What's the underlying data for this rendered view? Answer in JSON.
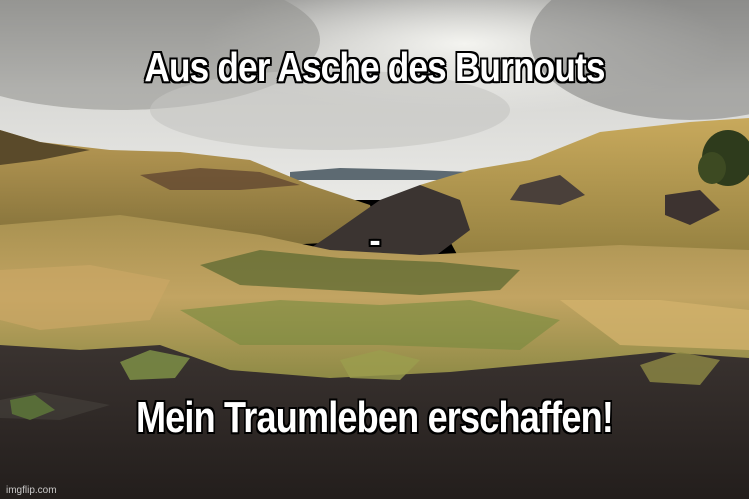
{
  "meme": {
    "top_text": "Aus der Asche des Burnouts",
    "middle_text": "-",
    "bottom_text": "Mein Traumleben erschaffen!",
    "watermark": "imgflip.com"
  },
  "colors": {
    "sky": "#d9d9d6",
    "cloud_dark": "#8a8a88",
    "dry_grass": "#c9a35a",
    "green_grass": "#7d8f43",
    "ash": "#2e2826",
    "text": "#ffffff",
    "outline": "#000000"
  }
}
